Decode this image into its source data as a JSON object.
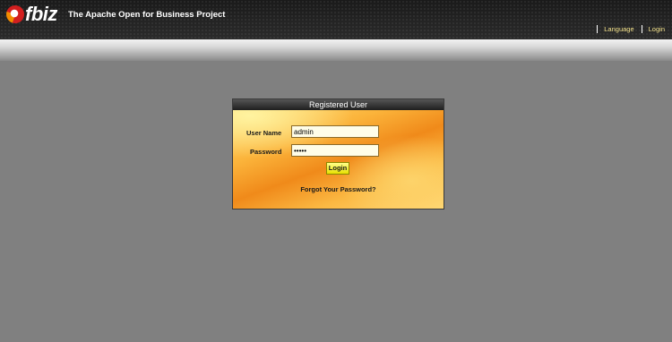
{
  "header": {
    "logo_text": "fbiz",
    "tagline": "The Apache Open for Business Project",
    "nav": {
      "language": "Language",
      "login": "Login"
    }
  },
  "login": {
    "title": "Registered User",
    "username_label": "User Name",
    "username_value": "admin",
    "password_label": "Password",
    "password_value": "•••••",
    "login_button": "Login",
    "forgot_password": "Forgot Your Password?"
  },
  "colors": {
    "page_background": "#808080",
    "header_background": "#1f1f1f",
    "nav_link": "#f2e08a",
    "login_button": "#f0e800",
    "box_gradient": "#f08a1a"
  },
  "icons": {
    "logo": "ofbiz-logo-icon"
  }
}
